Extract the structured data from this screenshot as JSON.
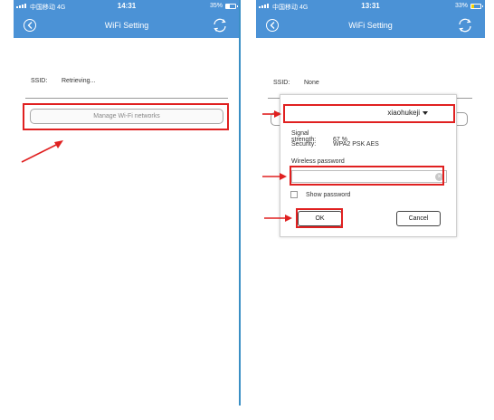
{
  "left_screen": {
    "status": {
      "carrier": "中国移动 4G",
      "time": "14:31",
      "battery": "35%",
      "battery_level": 0.35
    },
    "nav": {
      "title": "WiFi Setting"
    },
    "ssid_label": "SSID:",
    "ssid_value": "Retrieving...",
    "manage_button": "Manage Wi-Fi networks"
  },
  "right_screen": {
    "status": {
      "carrier": "中国移动 4G",
      "time": "13:31",
      "battery": "33%",
      "battery_level": 0.33
    },
    "nav": {
      "title": "WiFi Setting"
    },
    "ssid_label": "SSID:",
    "ssid_value": "None",
    "dialog": {
      "network_selected": "xiaohukeji",
      "signal_label": "Signal strength:",
      "signal_value": "67 %",
      "security_label": "Security:",
      "security_value": "WPA2 PSK AES",
      "password_label": "Wireless password",
      "password_value": "",
      "show_password_label": "Show password",
      "show_password_checked": false,
      "ok_button": "OK",
      "cancel_button": "Cancel"
    }
  },
  "colors": {
    "accent": "#4b92d6",
    "highlight": "#e02020"
  },
  "icons": [
    "back-icon",
    "refresh-icon",
    "signal-icon",
    "battery-icon",
    "dropdown-caret-icon",
    "clear-icon",
    "annotation-arrow-icon"
  ]
}
